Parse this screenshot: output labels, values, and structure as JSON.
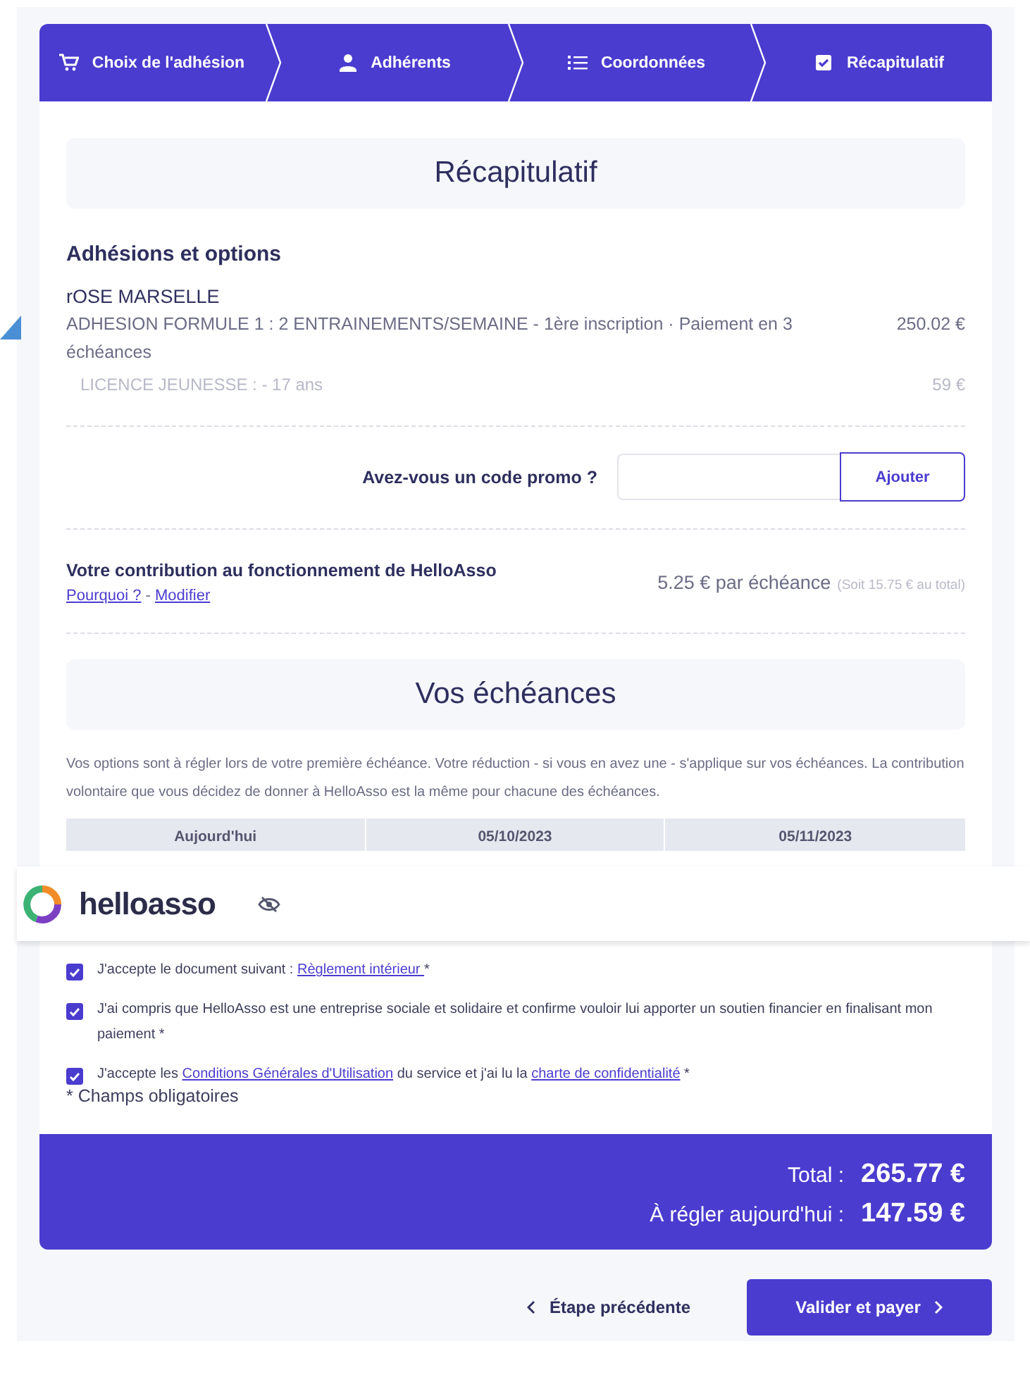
{
  "steps": [
    {
      "label": "Choix de l'adhésion"
    },
    {
      "label": "Adhérents"
    },
    {
      "label": "Coordonnées"
    },
    {
      "label": "Récapitulatif"
    }
  ],
  "title": "Récapitulatif",
  "memberships": {
    "heading": "Adhésions et options",
    "member": "rOSE MARSELLE",
    "lines": [
      {
        "kind": "main",
        "label": "ADHESION FORMULE 1 : 2 ENTRAINEMENTS/SEMAINE - 1ère inscription · Paiement en 3 échéances",
        "amount": "250.02 €"
      },
      {
        "kind": "option",
        "label": "LICENCE JEUNESSE : - 17 ans",
        "amount": "59 €"
      }
    ]
  },
  "promo": {
    "label": "Avez-vous un code promo ?",
    "button": "Ajouter"
  },
  "contribution": {
    "title": "Votre contribution au fonctionnement de HelloAsso",
    "links": [
      "Pourquoi ?",
      "Modifier"
    ],
    "separator": "-",
    "amount": "5.25 € par échéance",
    "total_note": "(Soit 15.75 € au total)"
  },
  "installments": {
    "title": "Vos échéances",
    "note": "Vos options sont à régler lors de votre première échéance. Votre réduction - si vous en avez une - s'applique sur vos échéances. La contribution volontaire que vous décidez de donner à HelloAsso est la même pour chacune des échéances.",
    "columns": [
      "Aujourd'hui",
      "05/10/2023",
      "05/11/2023"
    ]
  },
  "overlay": {
    "brand": "helloasso"
  },
  "agreements": [
    {
      "checked": true,
      "segments": [
        {
          "kind": "text",
          "text": "J'accepte le document suivant : "
        },
        {
          "kind": "link",
          "text": "Règlement intérieur "
        },
        {
          "kind": "text",
          "text": "*"
        }
      ]
    },
    {
      "checked": true,
      "segments": [
        {
          "kind": "text",
          "text": "J'ai compris que HelloAsso est une entreprise sociale et solidaire et confirme vouloir lui apporter un soutien financier en finalisant mon paiement *"
        }
      ]
    },
    {
      "checked": true,
      "segments": [
        {
          "kind": "text",
          "text": "J'accepte les "
        },
        {
          "kind": "link",
          "text": "Conditions Générales d'Utilisation"
        },
        {
          "kind": "text",
          "text": " du service et j'ai lu la "
        },
        {
          "kind": "link",
          "text": "charte de confidentialité"
        },
        {
          "kind": "text",
          "text": " *"
        }
      ]
    }
  ],
  "required_note": "* Champs obligatoires",
  "totals": [
    {
      "label": "Total :",
      "value": "265.77 €"
    },
    {
      "label": "À régler aujourd'hui :",
      "value": "147.59 €"
    }
  ],
  "nav": {
    "back": "Étape précédente",
    "submit": "Valider et payer"
  }
}
